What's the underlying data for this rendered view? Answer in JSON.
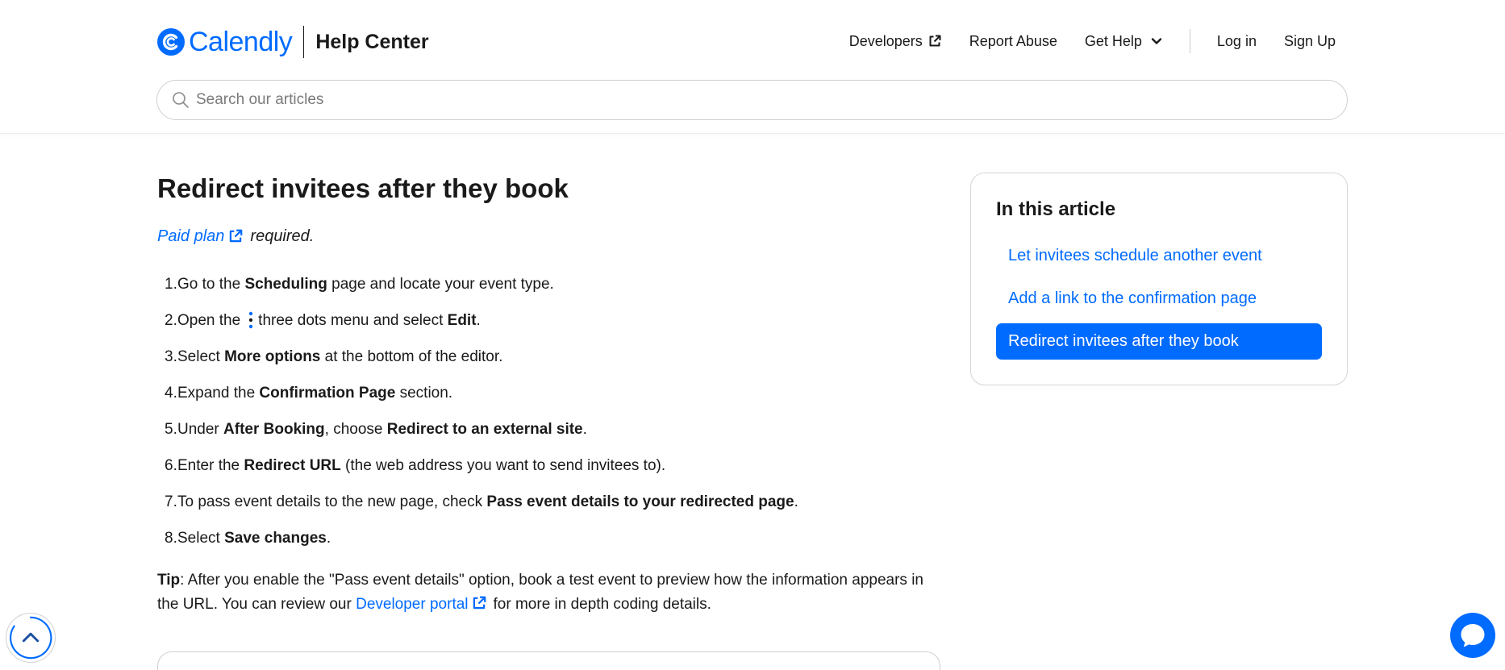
{
  "brand": {
    "name": "Calendly",
    "section": "Help Center"
  },
  "nav": {
    "developers": "Developers",
    "report_abuse": "Report Abuse",
    "get_help": "Get Help",
    "log_in": "Log in",
    "sign_up": "Sign Up"
  },
  "search": {
    "placeholder": "Search our articles",
    "value": ""
  },
  "article": {
    "title": "Redirect invitees after they book",
    "plan_link": "Paid plan",
    "plan_rest": "required.",
    "steps": [
      {
        "n": "1.",
        "a": "Go to the ",
        "b": "Scheduling",
        "c": " page and locate your event type."
      },
      {
        "n": "2.",
        "a": "Open the",
        "b2": "three dots menu and select ",
        "b": "Edit",
        "c": "."
      },
      {
        "n": "3.",
        "a": "Select ",
        "b": "More options",
        "c": " at the bottom of the editor."
      },
      {
        "n": "4.",
        "a": "Expand the ",
        "b": "Confirmation Page",
        "c": " section."
      },
      {
        "n": "5.",
        "a": "Under ",
        "b": "After Booking",
        "c": ", choose ",
        "d": "Redirect to an external site",
        "e": "."
      },
      {
        "n": "6.",
        "a": "Enter the ",
        "b": "Redirect URL",
        "c": " (the web address you want to send invitees to)."
      },
      {
        "n": "7.",
        "a": "To pass event details to the new page, check ",
        "b": "Pass event details to your redirected page",
        "c": "."
      },
      {
        "n": "8.",
        "a": "Select ",
        "b": "Save changes",
        "c": "."
      }
    ],
    "tip_label": "Tip",
    "tip_text_1": ": After you enable the \"Pass event details\" option, book a test event to preview how the information appears in the URL. You can review our ",
    "tip_link": "Developer portal",
    "tip_text_2": "for more in depth coding details."
  },
  "toc": {
    "heading": "In this article",
    "items": [
      {
        "label": "Let invitees schedule another event"
      },
      {
        "label": "Add a link to the confirmation page"
      },
      {
        "label": "Redirect invitees after they book"
      }
    ],
    "active_index": 2
  },
  "colors": {
    "brand_blue": "#006bff",
    "text": "#1a1a1a",
    "border": "#cfcfcf"
  },
  "icons": {
    "logo": "calendly-logo-icon",
    "external_link": "external-link-icon",
    "chevron": "chevron-down-icon",
    "search": "search-icon",
    "three_dots": "three-dots-vertical-icon",
    "scroll_top": "chevron-up-icon",
    "chat": "chat-bubble-icon"
  }
}
